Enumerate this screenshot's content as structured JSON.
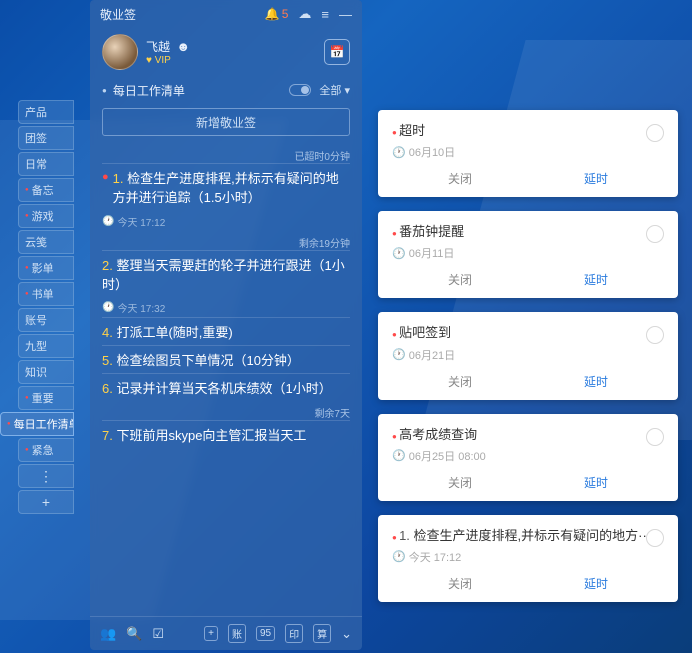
{
  "panel": {
    "app_title": "敬业签",
    "bell_count": "5",
    "user_name": "飞越",
    "vip_label": "VIP",
    "list_title": "每日工作清单",
    "filter_label": "全部",
    "add_button": "新增敬业签"
  },
  "side_tabs": [
    {
      "label": "产品",
      "red": false
    },
    {
      "label": "团签",
      "red": false
    },
    {
      "label": "日常",
      "red": false
    },
    {
      "label": "备忘",
      "red": true
    },
    {
      "label": "游戏",
      "red": true
    },
    {
      "label": "云笺",
      "red": false
    },
    {
      "label": "影单",
      "red": true
    },
    {
      "label": "书单",
      "red": true
    },
    {
      "label": "账号",
      "red": false
    },
    {
      "label": "九型",
      "red": false
    },
    {
      "label": "知识",
      "red": false
    },
    {
      "label": "重要",
      "red": true
    },
    {
      "label": "每日工作清单",
      "red": true,
      "active": true
    },
    {
      "label": "紧急",
      "red": true
    }
  ],
  "tasks": {
    "meta1": "已超时0分钟",
    "t1": {
      "num": "1.",
      "text": "检查生产进度排程,并标示有疑问的地方并进行追踪（1.5小时）",
      "time": "今天 17:12",
      "red": true
    },
    "meta2": "剩余19分钟",
    "t2": {
      "num": "2.",
      "text": "整理当天需要赶的轮子并进行跟进（1小时）",
      "time": "今天 17:32"
    },
    "t4": {
      "num": "4.",
      "text": "打派工单(随时,重要)",
      "time": ""
    },
    "t5": {
      "num": "5.",
      "text": "检查绘图员下单情况（10分钟）",
      "time": ""
    },
    "t6": {
      "num": "6.",
      "text": "记录并计算当天各机床绩效（1小时）",
      "time": ""
    },
    "meta3": "剩余7天",
    "t7": {
      "num": "7.",
      "text": "下班前用skype向主管汇报当天工",
      "time": ""
    }
  },
  "bottom_badges": [
    "账",
    "95",
    "印",
    "算"
  ],
  "cards": [
    {
      "title": "超时",
      "date": "06月10日",
      "close": "关闭",
      "delay": "延时"
    },
    {
      "title": "番茄钟提醒",
      "date": "06月11日",
      "close": "关闭",
      "delay": "延时"
    },
    {
      "title": "贴吧签到",
      "date": "06月21日",
      "close": "关闭",
      "delay": "延时"
    },
    {
      "title": "高考成绩查询",
      "date": "06月25日 08:00",
      "close": "关闭",
      "delay": "延时"
    },
    {
      "title": "检查生产进度排程,并标示有疑问的地方··",
      "date": "今天 17:12",
      "close": "关闭",
      "delay": "延时",
      "num": "1."
    }
  ]
}
